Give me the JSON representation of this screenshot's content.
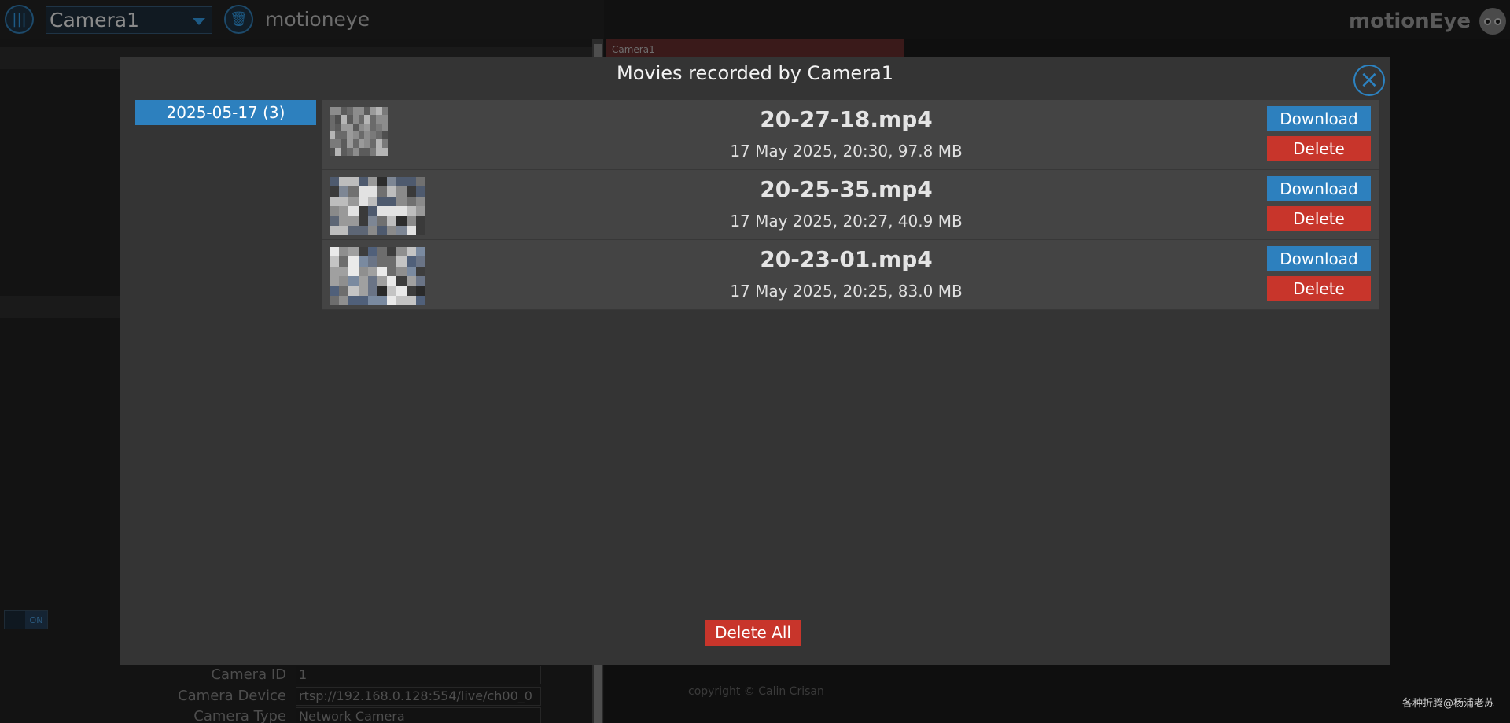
{
  "header": {
    "camera_select_value": "Camera1",
    "app_name": "motioneye",
    "brand": "motionEye"
  },
  "settings": {
    "toggle_state": "ON",
    "fields": [
      {
        "label": "Camera ID",
        "value": "1"
      },
      {
        "label": "Camera Device",
        "value": "rtsp://192.168.0.128:554/live/ch00_0"
      },
      {
        "label": "Camera Type",
        "value": "Network Camera"
      }
    ]
  },
  "camera_frame": {
    "name": "Camera1"
  },
  "footer": {
    "copyright": "copyright © Calin Crisan",
    "watermark": "各种折腾@杨浦老苏"
  },
  "modal": {
    "title": "Movies recorded by Camera1",
    "close_icon": "close-icon",
    "dates": [
      {
        "label": "2025-05-17 (3)",
        "selected": true
      }
    ],
    "movies": [
      {
        "name": "20-27-18.mp4",
        "info": "17 May 2025, 20:30, 97.8 MB"
      },
      {
        "name": "20-25-35.mp4",
        "info": "17 May 2025, 20:27, 40.9 MB"
      },
      {
        "name": "20-23-01.mp4",
        "info": "17 May 2025, 20:25, 83.0 MB"
      }
    ],
    "download_label": "Download",
    "delete_label": "Delete",
    "delete_all_label": "Delete All"
  },
  "colors": {
    "accent_blue": "#2d80be",
    "danger_red": "#c8352b",
    "modal_bg": "#343434",
    "row_bg": "#444444"
  }
}
